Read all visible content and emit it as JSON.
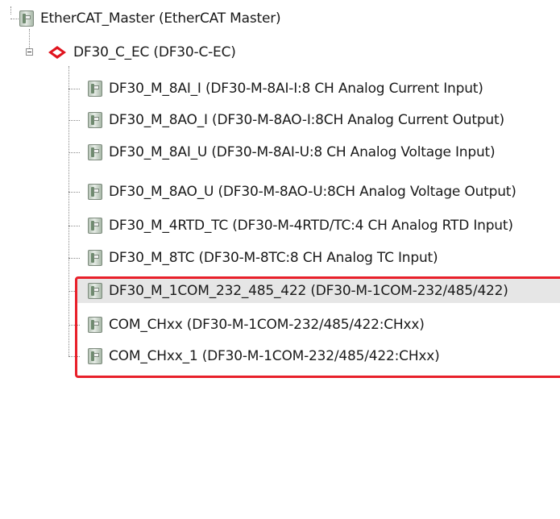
{
  "tree": {
    "root": {
      "label": "EtherCAT_Master (EtherCAT Master)",
      "icon": "module-icon"
    },
    "coupler": {
      "label": "DF30_C_EC (DF30-C-EC)",
      "icon": "coupler-icon",
      "expanded": true
    },
    "modules": [
      {
        "label": "DF30_M_8AI_I (DF30-M-8AI-I:8 CH Analog Current Input)",
        "icon": "module-icon"
      },
      {
        "label": "DF30_M_8AO_I (DF30-M-8AO-I:8CH Analog Current Output)",
        "icon": "module-icon"
      },
      {
        "label": "DF30_M_8AI_U (DF30-M-8AI-U:8 CH Analog Voltage Input)",
        "icon": "module-icon"
      },
      {
        "label": "DF30_M_8AO_U (DF30-M-8AO-U:8CH Analog Voltage Output)",
        "icon": "module-icon"
      },
      {
        "label": "DF30_M_4RTD_TC (DF30-M-4RTD/TC:4 CH Analog RTD Input)",
        "icon": "module-icon"
      },
      {
        "label": "DF30_M_8TC (DF30-M-8TC:8 CH Analog TC Input)",
        "icon": "module-icon"
      },
      {
        "label": "DF30_M_1COM_232_485_422 (DF30-M-1COM-232/485/422)",
        "icon": "module-icon",
        "selected": true
      },
      {
        "label": "COM_CHxx (DF30-M-1COM-232/485/422:CHxx)",
        "icon": "module-icon"
      },
      {
        "label": "COM_CHxx_1 (DF30-M-1COM-232/485/422:CHxx)",
        "icon": "module-icon"
      }
    ]
  },
  "highlight_color": "#e8202a",
  "coupler_icon_color": "#e0141e"
}
